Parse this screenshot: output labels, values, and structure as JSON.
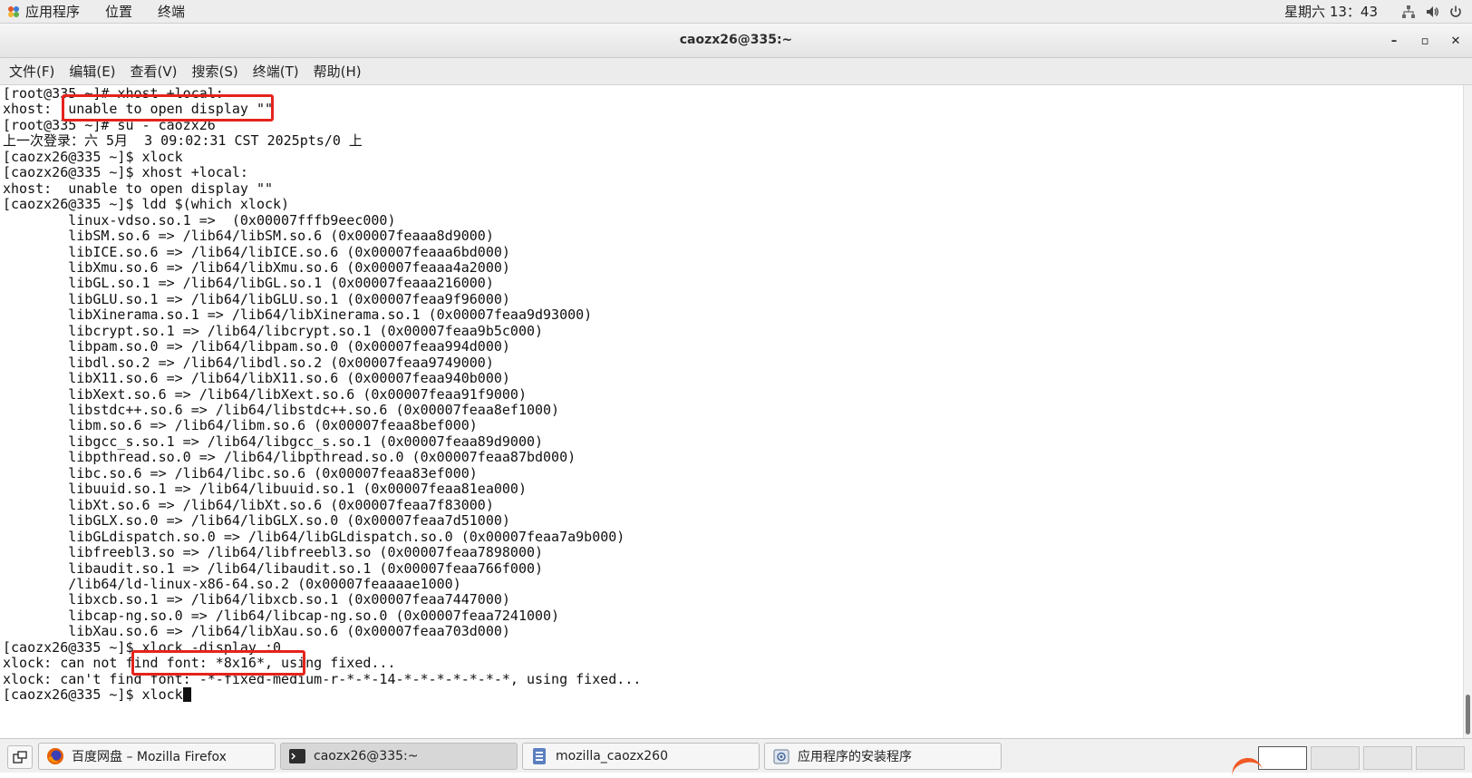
{
  "top_panel": {
    "applications": "应用程序",
    "places": "位置",
    "terminal": "终端",
    "clock": "星期六 13：43"
  },
  "window": {
    "title": "caozx26@335:~",
    "minimize": "–",
    "maximize": "▫",
    "close": "✕"
  },
  "menubar": [
    "文件(F)",
    "编辑(E)",
    "查看(V)",
    "搜索(S)",
    "终端(T)",
    "帮助(H)"
  ],
  "terminal": {
    "lines": [
      "[root@335 ~]# xhost +local:",
      "xhost:  unable to open display \"\"",
      "[root@335 ~]# su - caozx26",
      "上一次登录：六 5月  3 09:02:31 CST 2025pts/0 上",
      "[caozx26@335 ~]$ xlock",
      "[caozx26@335 ~]$ xhost +local:",
      "xhost:  unable to open display \"\"",
      "[caozx26@335 ~]$ ldd $(which xlock)",
      "        linux-vdso.so.1 =>  (0x00007fffb9eec000)",
      "        libSM.so.6 => /lib64/libSM.so.6 (0x00007feaaa8d9000)",
      "        libICE.so.6 => /lib64/libICE.so.6 (0x00007feaaa6bd000)",
      "        libXmu.so.6 => /lib64/libXmu.so.6 (0x00007feaaa4a2000)",
      "        libGL.so.1 => /lib64/libGL.so.1 (0x00007feaaa216000)",
      "        libGLU.so.1 => /lib64/libGLU.so.1 (0x00007feaa9f96000)",
      "        libXinerama.so.1 => /lib64/libXinerama.so.1 (0x00007feaa9d93000)",
      "        libcrypt.so.1 => /lib64/libcrypt.so.1 (0x00007feaa9b5c000)",
      "        libpam.so.0 => /lib64/libpam.so.0 (0x00007feaa994d000)",
      "        libdl.so.2 => /lib64/libdl.so.2 (0x00007feaa9749000)",
      "        libX11.so.6 => /lib64/libX11.so.6 (0x00007feaa940b000)",
      "        libXext.so.6 => /lib64/libXext.so.6 (0x00007feaa91f9000)",
      "        libstdc++.so.6 => /lib64/libstdc++.so.6 (0x00007feaa8ef1000)",
      "        libm.so.6 => /lib64/libm.so.6 (0x00007feaa8bef000)",
      "        libgcc_s.so.1 => /lib64/libgcc_s.so.1 (0x00007feaa89d9000)",
      "        libpthread.so.0 => /lib64/libpthread.so.0 (0x00007feaa87bd000)",
      "        libc.so.6 => /lib64/libc.so.6 (0x00007feaa83ef000)",
      "        libuuid.so.1 => /lib64/libuuid.so.1 (0x00007feaa81ea000)",
      "        libXt.so.6 => /lib64/libXt.so.6 (0x00007feaa7f83000)",
      "        libGLX.so.0 => /lib64/libGLX.so.0 (0x00007feaa7d51000)",
      "        libGLdispatch.so.0 => /lib64/libGLdispatch.so.0 (0x00007feaa7a9b000)",
      "        libfreebl3.so => /lib64/libfreebl3.so (0x00007feaa7898000)",
      "        libaudit.so.1 => /lib64/libaudit.so.1 (0x00007feaa766f000)",
      "        /lib64/ld-linux-x86-64.so.2 (0x00007feaaaae1000)",
      "        libxcb.so.1 => /lib64/libxcb.so.1 (0x00007feaa7447000)",
      "        libcap-ng.so.0 => /lib64/libcap-ng.so.0 (0x00007feaa7241000)",
      "        libXau.so.6 => /lib64/libXau.so.6 (0x00007feaa703d000)",
      "[caozx26@335 ~]$ xlock -display :0",
      "xlock: can not find font: *8x16*, using fixed...",
      "xlock: can't find font: -*-fixed-medium-r-*-*-14-*-*-*-*-*-*-*, using fixed...",
      "[caozx26@335 ~]$ xlock"
    ]
  },
  "taskbar": {
    "tasks": [
      {
        "label": "百度网盘 – Mozilla Firefox",
        "icon": "firefox-icon"
      },
      {
        "label": "caozx26@335:~",
        "icon": "terminal-icon"
      },
      {
        "label": "mozilla_caozx260",
        "icon": "file-manager-icon"
      },
      {
        "label": "应用程序的安装程序",
        "icon": "installer-icon"
      }
    ]
  },
  "colors": {
    "highlight": "#e5231c",
    "accent_orange": "#f05a26"
  }
}
